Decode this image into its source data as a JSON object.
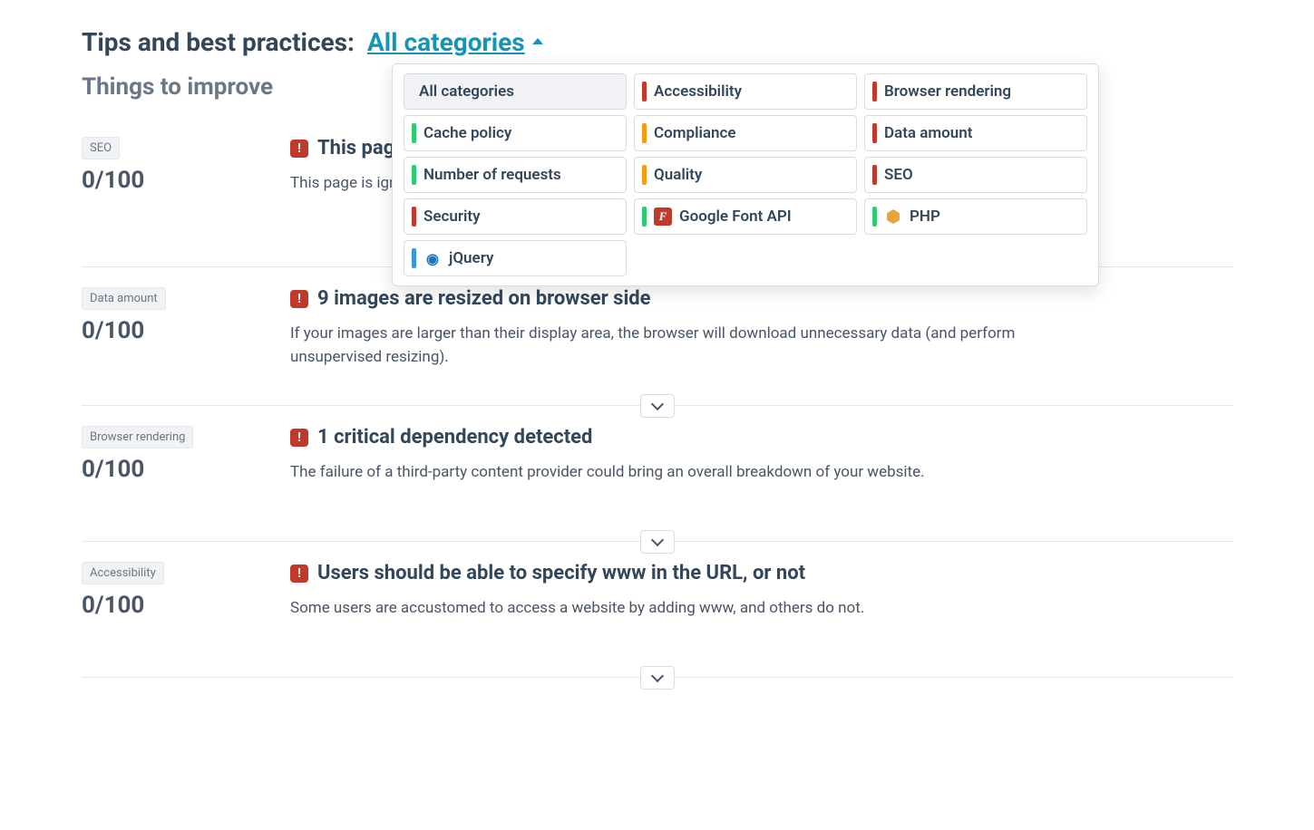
{
  "header": {
    "title": "Tips and best practices:",
    "dropdown_label": "All categories"
  },
  "subheading": "Things to improve",
  "filters": [
    {
      "label": "All categories",
      "stripe": null,
      "tech": null,
      "selected": true
    },
    {
      "label": "Accessibility",
      "stripe": "red",
      "tech": null
    },
    {
      "label": "Browser rendering",
      "stripe": "red",
      "tech": null
    },
    {
      "label": "Cache policy",
      "stripe": "green",
      "tech": null
    },
    {
      "label": "Compliance",
      "stripe": "orange",
      "tech": null
    },
    {
      "label": "Data amount",
      "stripe": "red",
      "tech": null
    },
    {
      "label": "Number of requests",
      "stripe": "green",
      "tech": null
    },
    {
      "label": "Quality",
      "stripe": "orange",
      "tech": null
    },
    {
      "label": "SEO",
      "stripe": "red",
      "tech": null
    },
    {
      "label": "Security",
      "stripe": "red",
      "tech": null
    },
    {
      "label": "Google Font API",
      "stripe": "green",
      "tech": "google-font",
      "tech_glyph": "F"
    },
    {
      "label": "PHP",
      "stripe": "green",
      "tech": "php",
      "tech_glyph": "⬢"
    },
    {
      "label": "jQuery",
      "stripe": "blue",
      "tech": "jquery",
      "tech_glyph": "◉"
    }
  ],
  "issues": [
    {
      "category": "SEO",
      "score": "0/100",
      "title": "This pag",
      "description": "This page is ign"
    },
    {
      "category": "Data amount",
      "score": "0/100",
      "title": "9 images are resized on browser side",
      "description": "If your images are larger than their display area, the browser will download unnecessary data (and perform unsupervised resizing)."
    },
    {
      "category": "Browser rendering",
      "score": "0/100",
      "title": "1 critical dependency detected",
      "description": "The failure of a third-party content provider could bring an overall breakdown of your website."
    },
    {
      "category": "Accessibility",
      "score": "0/100",
      "title": "Users should be able to specify www in the URL, or not",
      "description": "Some users are accustomed to access a website by adding www, and others do not."
    }
  ]
}
